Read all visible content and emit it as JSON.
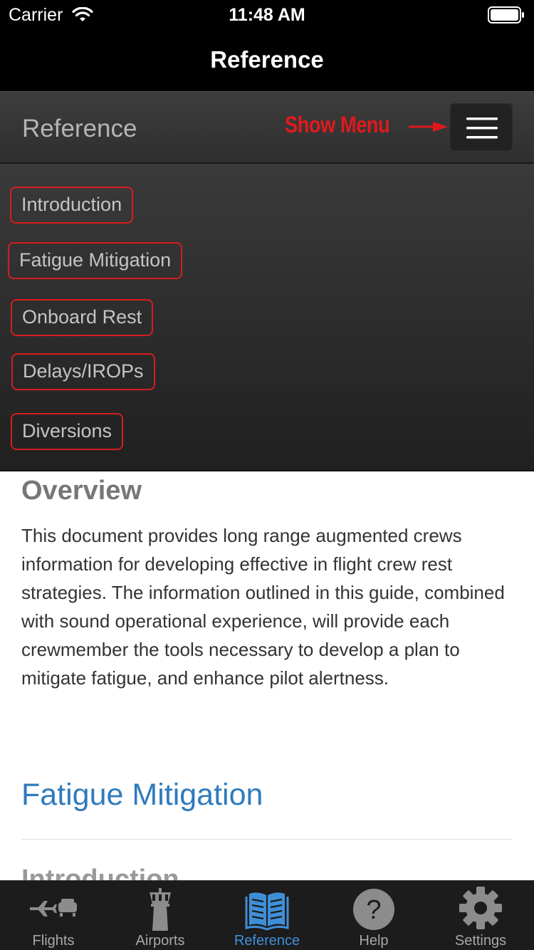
{
  "status_bar": {
    "carrier": "Carrier",
    "time": "11:48 AM"
  },
  "nav": {
    "title": "Reference"
  },
  "header": {
    "title": "Reference",
    "annotation": "Show Menu",
    "annotation_color": "#e0191c"
  },
  "menu": {
    "items": [
      {
        "label": "Introduction"
      },
      {
        "label": "Fatigue Mitigation"
      },
      {
        "label": "Onboard Rest"
      },
      {
        "label": "Delays/IROPs"
      },
      {
        "label": "Diversions"
      }
    ]
  },
  "content": {
    "overview_heading": "Overview",
    "overview_text": "This document provides long range augmented crews information for developing effective in flight crew rest strategies. The information outlined in this guide, combined with sound operational experience, will provide each crewmember the tools necessary to develop a plan to mitigate fatigue, and enhance pilot alertness.",
    "section_heading": "Fatigue Mitigation",
    "next_heading": "Introduction",
    "accent_color": "#2f7bbd"
  },
  "tabs": [
    {
      "label": "Flights",
      "icon": "plane-icon"
    },
    {
      "label": "Airports",
      "icon": "tower-icon"
    },
    {
      "label": "Reference",
      "icon": "book-icon",
      "active": true
    },
    {
      "label": "Help",
      "icon": "question-icon"
    },
    {
      "label": "Settings",
      "icon": "gear-icon"
    }
  ]
}
